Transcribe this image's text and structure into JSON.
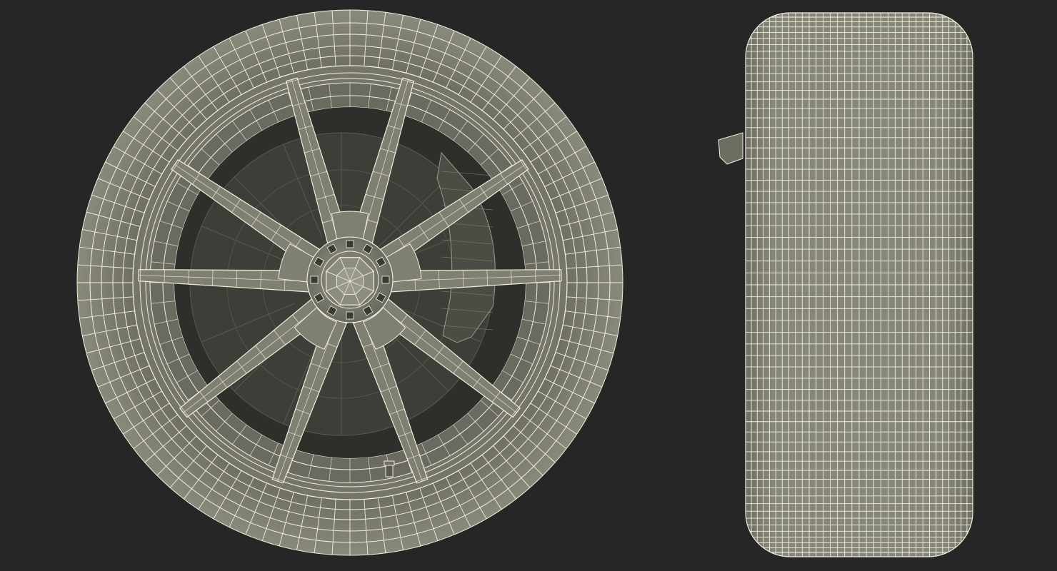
{
  "scene": {
    "background": "#262626",
    "mesh_fill": "#7f7f72",
    "mesh_fill_dark": "#5d5d53",
    "interior_fill": "#3c3c37",
    "wire_color": "#f2f0df",
    "views": [
      {
        "name": "front-view",
        "subject": "wheel-with-tire",
        "spoke_count": 10
      },
      {
        "name": "side-view",
        "subject": "tire-profile"
      }
    ]
  }
}
